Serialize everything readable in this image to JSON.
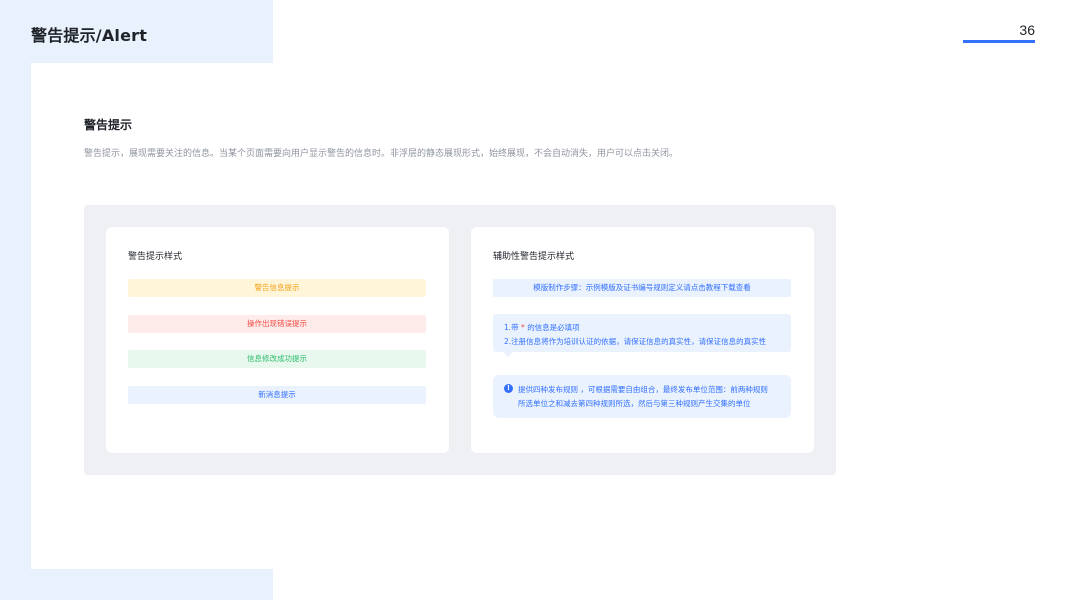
{
  "header": {
    "title": "警告提示/Alert",
    "page_number": "36"
  },
  "section": {
    "title": "警告提示",
    "description": "警告提示，展现需要关注的信息。当某个页面需要向用户显示警告的信息时。非浮层的静态展现形式，始终展现，不会自动消失，用户可以点击关闭。"
  },
  "left_card": {
    "title": "警告提示样式",
    "alerts": [
      {
        "type": "warning",
        "text": "警告信息提示"
      },
      {
        "type": "error",
        "text": "操作出现错误提示"
      },
      {
        "type": "success",
        "text": "信息修改成功提示"
      },
      {
        "type": "info",
        "text": "新消息提示"
      }
    ]
  },
  "right_card": {
    "title": "辅助性警告提示样式",
    "assist_1": "模版制作步骤：示例模版及证书编号规则定义请点击教程下载查看",
    "assist_2": {
      "line1_prefix": "1.带",
      "line1_star": "*",
      "line1_suffix": "的信息是必填项",
      "line2": "2.注册信息将作为培训认证的依据，请保证信息的真实性，请保证信息的真实性"
    },
    "assist_3": {
      "icon": "info-icon",
      "icon_glyph": "!",
      "line1": "提供四种发布规则 ，可根据需要自由组合，最终发布单位范围：前两种规则",
      "line2": "所选单位之和减去第四种规则所选，然后与第三种规则产生交集的单位"
    }
  },
  "colors": {
    "accent": "#3370ff",
    "warning": "#f5a31a",
    "error": "#f54a45",
    "success": "#2ebd6b",
    "decor_bg": "#e9f1fd",
    "panel_bg": "#eef0f4"
  }
}
